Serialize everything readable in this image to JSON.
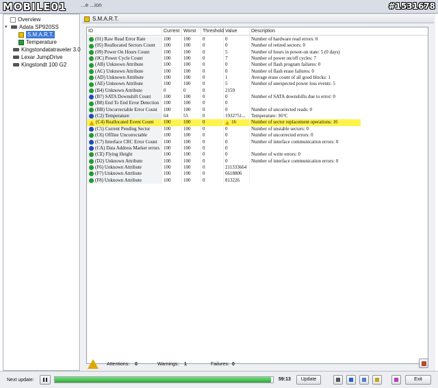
{
  "watermark": {
    "logo": "MOBILE01",
    "photo_id": "#1531678"
  },
  "menu_fragment": "...e   ...ion",
  "tree": {
    "items": [
      {
        "label": "Overview",
        "level": 2,
        "icon": "document-icon"
      },
      {
        "label": "Adata  SP920SS",
        "level": 1,
        "icon": "drive-icon",
        "expanded": true
      },
      {
        "label": "S.M.A.R.T.",
        "level": 2,
        "icon": "smart-icon",
        "selected": true
      },
      {
        "label": "Temperature",
        "level": 2,
        "icon": "thermometer-icon"
      },
      {
        "label": "Kingstondatatraveler 3.0",
        "level": 1,
        "icon": "drive-icon"
      },
      {
        "label": "Lexar  JumpDrive",
        "level": 1,
        "icon": "drive-icon"
      },
      {
        "label": "Kingstondt 100 G2",
        "level": 1,
        "icon": "drive-icon"
      }
    ]
  },
  "panel": {
    "title": "S.M.A.R.T."
  },
  "table": {
    "columns": [
      "ID",
      "Current",
      "Worst",
      "Threshold",
      "Value",
      "Description"
    ],
    "rows": [
      {
        "status": "good",
        "id": "(01) Raw Read Error Rate",
        "current": "100",
        "worst": "100",
        "threshold": "0",
        "value": "0",
        "description": "Number of hardware read errors: 0"
      },
      {
        "status": "good",
        "id": "(05) Reallocated Sectors Count",
        "current": "100",
        "worst": "100",
        "threshold": "0",
        "value": "0",
        "description": "Number of retired sectors: 0"
      },
      {
        "status": "good",
        "id": "(09) Power On Hours Count",
        "current": "100",
        "worst": "100",
        "threshold": "0",
        "value": "5",
        "description": "Number of hours in power-on state: 5 (0 days)"
      },
      {
        "status": "good",
        "id": "(0C) Power Cycle Count",
        "current": "100",
        "worst": "100",
        "threshold": "0",
        "value": "7",
        "description": "Number of power on/off cycles: 7"
      },
      {
        "status": "good",
        "id": "(AB) Unknown Attribute",
        "current": "100",
        "worst": "100",
        "threshold": "0",
        "value": "0",
        "description": "Number of flash program failures: 0"
      },
      {
        "status": "good",
        "id": "(AC) Unknown Attribute",
        "current": "100",
        "worst": "100",
        "threshold": "0",
        "value": "0",
        "description": "Number of flash erase failures: 0"
      },
      {
        "status": "good",
        "id": "(AD) Unknown Attribute",
        "current": "100",
        "worst": "100",
        "threshold": "0",
        "value": "1",
        "description": "Average erase count of all good blocks: 1"
      },
      {
        "status": "good",
        "id": "(AE) Unknown Attribute",
        "current": "100",
        "worst": "100",
        "threshold": "0",
        "value": "5",
        "description": "Number of unexpected power loss events: 5"
      },
      {
        "status": "good",
        "id": "(B4) Unknown Attribute",
        "current": "0",
        "worst": "0",
        "threshold": "0",
        "value": "2159",
        "description": ""
      },
      {
        "status": "info",
        "id": "(B7) SATA Downshift Count",
        "current": "100",
        "worst": "100",
        "threshold": "0",
        "value": "0",
        "description": "Number of SATA downshifts due to error: 0"
      },
      {
        "status": "good",
        "id": "(B8) End To End Error Detection",
        "current": "100",
        "worst": "100",
        "threshold": "0",
        "value": "0",
        "description": ""
      },
      {
        "status": "good",
        "id": "(BB) Uncorrectable Error Count",
        "current": "100",
        "worst": "100",
        "threshold": "0",
        "value": "0",
        "description": "Number of uncorrected reads: 0"
      },
      {
        "status": "info",
        "id": "(C2) Temperature",
        "current": "64",
        "worst": "55",
        "threshold": "0",
        "value": "1932751...",
        "description": "Temperature: 36°C",
        "selected": true
      },
      {
        "status": "warn",
        "id": "(C4) Reallocated Event Count",
        "current": "100",
        "worst": "100",
        "threshold": "0",
        "value": "16",
        "value_warn": true,
        "description": "Number of sector replacement operations: 16",
        "highlight": true
      },
      {
        "status": "info",
        "id": "(C5) Current Pending Sector",
        "current": "100",
        "worst": "100",
        "threshold": "0",
        "value": "0",
        "description": "Number of unstable sectors: 0"
      },
      {
        "status": "good",
        "id": "(C6) Offline Uncorrectable",
        "current": "100",
        "worst": "100",
        "threshold": "0",
        "value": "0",
        "description": "Number of uncorrected errors: 0"
      },
      {
        "status": "info",
        "id": "(C7) Interface CRC Error Count",
        "current": "100",
        "worst": "100",
        "threshold": "0",
        "value": "0",
        "description": "Number of interface communication errors: 0"
      },
      {
        "status": "info",
        "id": "(CA) Data Address Marker errors",
        "current": "100",
        "worst": "100",
        "threshold": "0",
        "value": "0",
        "description": ""
      },
      {
        "status": "good",
        "id": "(CE) Flying Height",
        "current": "100",
        "worst": "100",
        "threshold": "0",
        "value": "0",
        "description": "Number of write errors: 0"
      },
      {
        "status": "good",
        "id": "(D2) Unknown Attribute",
        "current": "100",
        "worst": "100",
        "threshold": "0",
        "value": "0",
        "description": "Number of interface communication errors: 0"
      },
      {
        "status": "good",
        "id": "(F6) Unknown Attribute",
        "current": "100",
        "worst": "100",
        "threshold": "0",
        "value": "211333664",
        "description": ""
      },
      {
        "status": "good",
        "id": "(F7) Unknown Attribute",
        "current": "100",
        "worst": "100",
        "threshold": "0",
        "value": "6618806",
        "description": ""
      },
      {
        "status": "good",
        "id": "(F8) Unknown Attribute",
        "current": "100",
        "worst": "100",
        "threshold": "0",
        "value": "813226",
        "description": ""
      }
    ]
  },
  "summary": {
    "attentions_label": "Attentions:",
    "attentions": "0",
    "warnings_label": "Warnings:",
    "warnings": "1",
    "failures_label": "Failures:",
    "failures": "0"
  },
  "bottom": {
    "next_update_label": "Next update:",
    "countdown": "59:13",
    "progress_percent": 99,
    "update_label": "Update",
    "exit_label": "Exit"
  },
  "colors": {
    "highlight": "#fff34a",
    "status_good": "#1f9c2f",
    "status_info": "#1f49b8",
    "status_warn": "#e0a700",
    "selection": "#3b78d8"
  }
}
